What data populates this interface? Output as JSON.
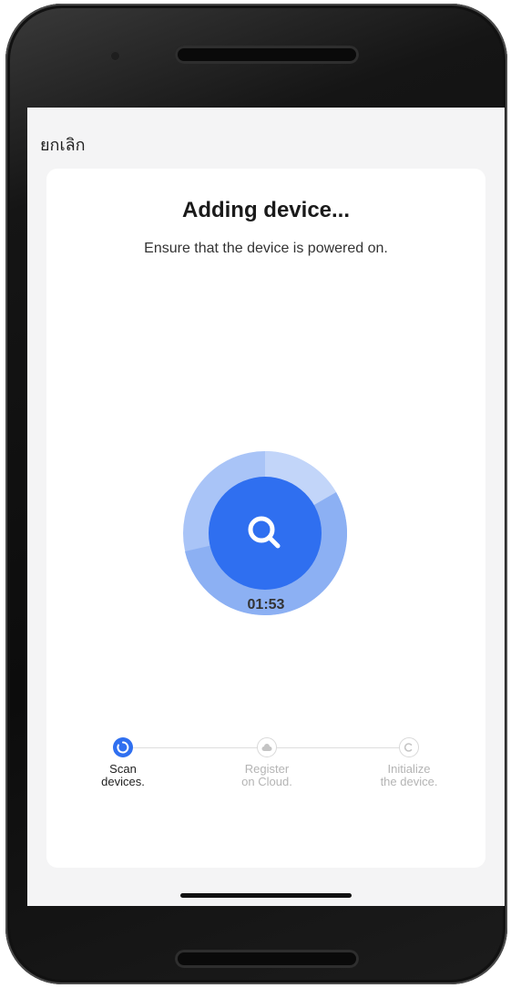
{
  "header": {
    "cancel_label": "ยกเลิก"
  },
  "main": {
    "title": "Adding device...",
    "subtitle": "Ensure that the device is powered on.",
    "timer": "01:53",
    "scan_icon": "search-icon"
  },
  "steps": [
    {
      "label": "Scan\ndevices.",
      "state": "active",
      "icon": "spinner-icon"
    },
    {
      "label": "Register\non Cloud.",
      "state": "pending",
      "icon": "cloud-icon"
    },
    {
      "label": "Initialize\nthe device.",
      "state": "pending",
      "icon": "c-circle-icon"
    }
  ],
  "colors": {
    "accent": "#2f6ff0",
    "ring_outer": "#a9c4f7",
    "ring_progress": "#8cb0f3",
    "screen_bg": "#f4f4f5"
  }
}
